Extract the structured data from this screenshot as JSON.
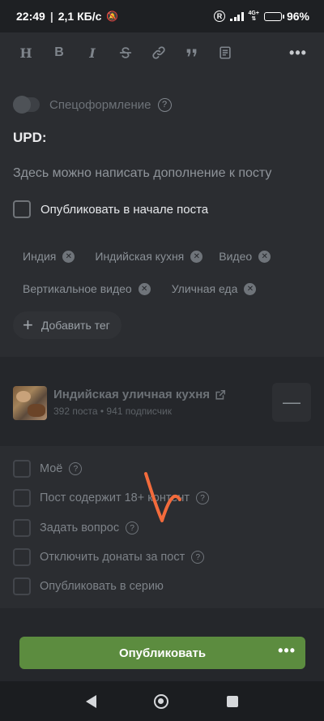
{
  "status_bar": {
    "time": "22:49",
    "speed": "2,1 КБ/с",
    "network_label": "4G+",
    "battery": "96%"
  },
  "toolbar": {
    "heading_label": "H",
    "bold_label": "B",
    "italic_label": "I",
    "more_label": "•••"
  },
  "editor": {
    "special_format_label": "Спецоформление",
    "upd_label": "UPD:",
    "addon_placeholder": "Здесь можно написать дополнение к посту",
    "publish_at_start_label": "Опубликовать в начале поста"
  },
  "tags": [
    "Индия",
    "Индийская кухня",
    "Видео",
    "Вертикальное видео",
    "Уличная еда"
  ],
  "add_tag_label": "Добавить тег",
  "community": {
    "name": "Индийская уличная кухня",
    "meta": "392 поста • 941 подписчик",
    "collapse_label": "—"
  },
  "options": [
    {
      "label": "Моё",
      "help": true
    },
    {
      "label": "Пост содержит 18+ контент",
      "help": true
    },
    {
      "label": "Задать вопрос",
      "help": true
    },
    {
      "label": "Отключить донаты за пост",
      "help": true
    },
    {
      "label": "Опубликовать в серию",
      "help": false
    }
  ],
  "publish": {
    "label": "Опубликовать",
    "more_label": "•••"
  },
  "colors": {
    "accent_green": "#5c8c3f",
    "annotation_orange": "#f36b3c"
  }
}
